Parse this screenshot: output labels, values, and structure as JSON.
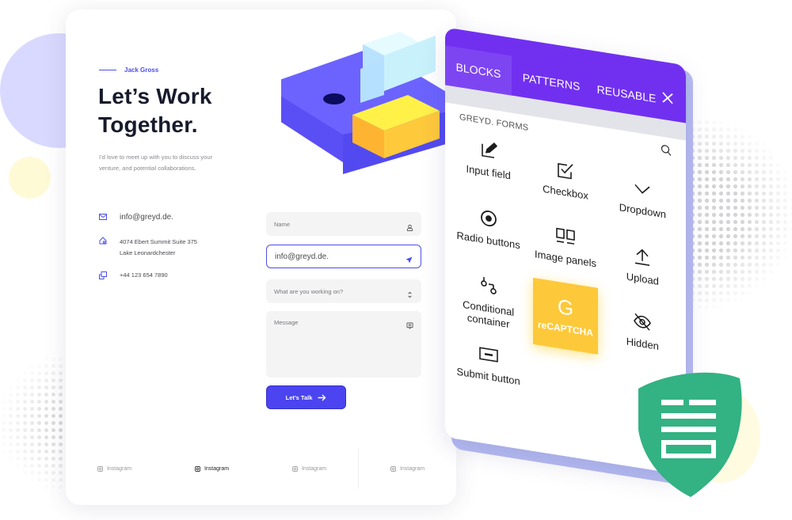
{
  "contact_card": {
    "eyebrow": "Jack Gross",
    "title_line1": "Let’s Work",
    "title_line2": "Together.",
    "intro": "I’d love to meet up with you to discuss your venture, and potential collaborations.",
    "email": "info@greyd.de.",
    "address_line1": "4074 Ebert Summit Suite 375",
    "address_line2": "Lake Leonardchester",
    "phone": "+44 123 654 7890",
    "form": {
      "name_placeholder": "Name",
      "email_value": "info@greyd.de.",
      "work_placeholder": "What are you working on?",
      "message_placeholder": "Message",
      "submit_label": "Let’s Talk"
    },
    "socials": [
      {
        "label": "Instagram",
        "active": false
      },
      {
        "label": "Instagram",
        "active": true
      },
      {
        "label": "Instagram",
        "active": false
      },
      {
        "label": "Instagram",
        "active": false
      }
    ],
    "accent_color": "#4b4dee"
  },
  "blocks_panel": {
    "tabs": [
      {
        "label": "BLOCKS",
        "active": true
      },
      {
        "label": "PATTERNS",
        "active": false
      },
      {
        "label": "REUSABLE",
        "active": false
      }
    ],
    "section_label": "GREYD. FORMS",
    "header_color": "#7130f0",
    "blocks": [
      {
        "label": "Input field",
        "icon": "edit-icon"
      },
      {
        "label": "Checkbox",
        "icon": "checkbox-icon"
      },
      {
        "label": "Dropdown",
        "icon": "chevron-down-icon"
      },
      {
        "label": "Radio buttons",
        "icon": "radio-icon"
      },
      {
        "label": "Image panels",
        "icon": "image-panels-icon"
      },
      {
        "label": "Upload",
        "icon": "upload-icon"
      },
      {
        "label": "Conditional container",
        "icon": "conditional-icon"
      },
      {
        "label": "reCAPTCHA",
        "icon": "google-g-icon",
        "glyph": "G"
      },
      {
        "label": "Hidden",
        "icon": "eye-off-icon"
      },
      {
        "label": "Submit button",
        "icon": "submit-button-icon"
      }
    ]
  },
  "badge": {
    "color": "#33b283"
  }
}
